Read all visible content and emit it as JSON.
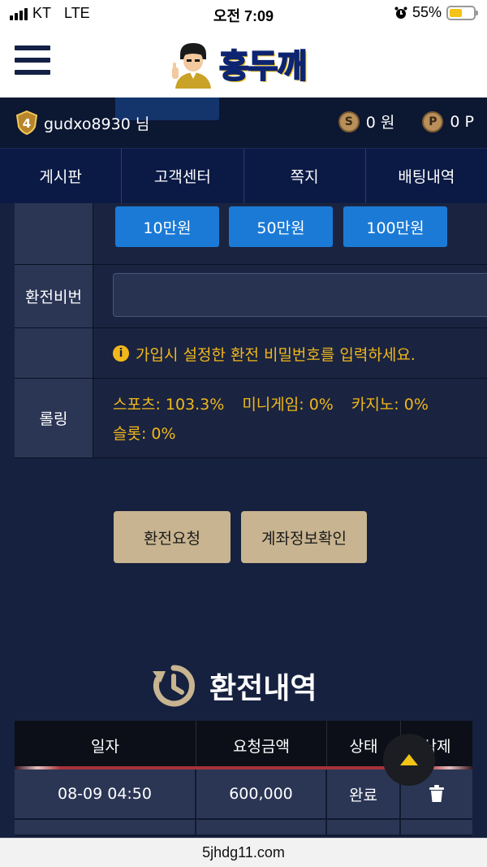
{
  "status_bar": {
    "carrier": "KT",
    "network": "LTE",
    "time": "오전 7:09",
    "battery": "55%",
    "battery_level": 0.55,
    "battery_color": "#f3c316"
  },
  "header": {
    "menu_icon": "hamburger-icon",
    "logo_text": "홍두깨"
  },
  "user": {
    "level": "4",
    "username": "gudxo8930 님",
    "cash": "0 원",
    "points": "0 P",
    "cash_icon_label": "S",
    "points_icon_label": "P"
  },
  "tabs": [
    {
      "label": "게시판"
    },
    {
      "label": "고객센터"
    },
    {
      "label": "쪽지"
    },
    {
      "label": "배팅내역"
    }
  ],
  "form": {
    "amount_buttons": [
      {
        "label": "10만원"
      },
      {
        "label": "50만원"
      },
      {
        "label": "100만원"
      }
    ],
    "password_label": "환전비번",
    "password_value": "",
    "notice": "가입시 설정한 환전 비밀번호를 입력하세요.",
    "rolling_label": "롤링",
    "rolling_items": [
      "스포츠: 103.3%",
      "미니게임: 0%",
      "카지노: 0%",
      "슬롯: 0%"
    ]
  },
  "actions": {
    "request_label": "환전요청",
    "account_label": "계좌정보확인"
  },
  "history": {
    "title": "환전내역",
    "columns": [
      "일자",
      "요청금액",
      "상태",
      "삭제"
    ],
    "rows": [
      {
        "date": "08-09 04:50",
        "amount": "600,000",
        "status": "완료"
      }
    ]
  },
  "url_bar": {
    "url": "5jhdg11.com"
  },
  "colors": {
    "accent_blue": "#1b7ad6",
    "notice_yellow": "#f2b71a",
    "action_tan": "#c8b490",
    "nav_dark": "#0b1a45"
  }
}
